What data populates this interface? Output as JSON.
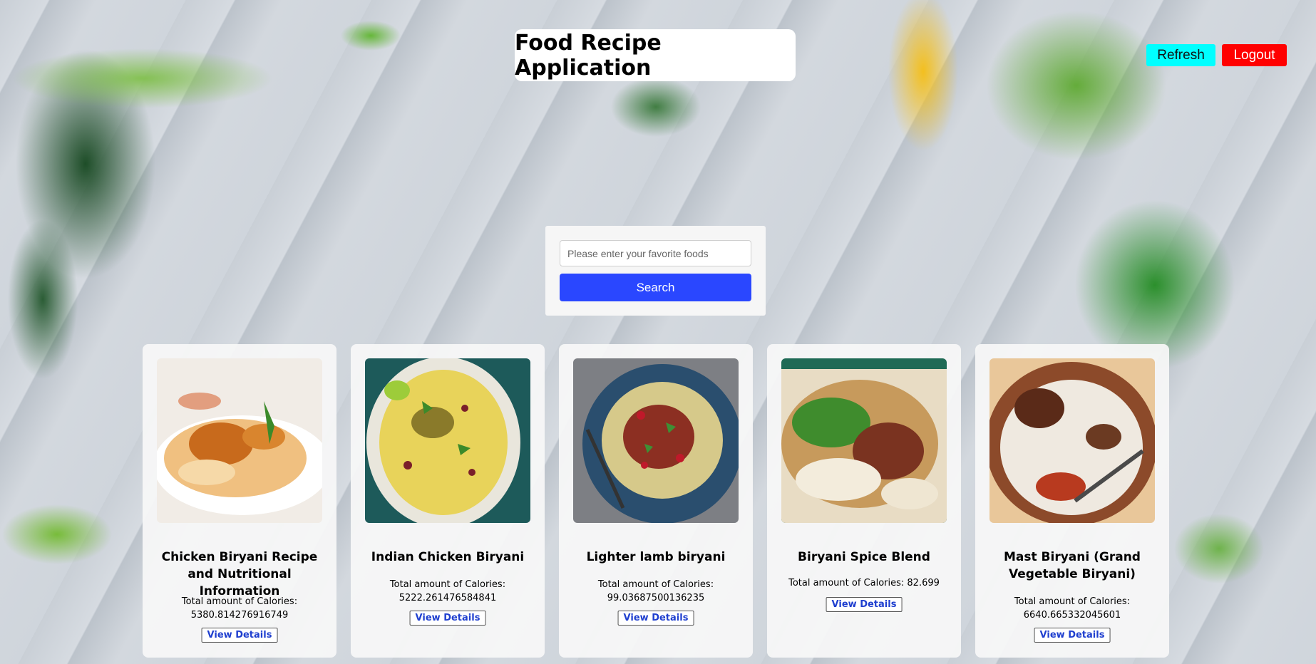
{
  "app": {
    "title": "Food Recipe Application"
  },
  "header": {
    "refresh_label": "Refresh",
    "logout_label": "Logout"
  },
  "search": {
    "placeholder": "Please enter your favorite foods",
    "value": "",
    "button_label": "Search"
  },
  "recipes": [
    {
      "title": "Chicken Biryani Recipe and Nutritional Information",
      "calories_label": "Total amount of Calories:",
      "calories": "5380.814276916749",
      "button": "View Details"
    },
    {
      "title": "Indian Chicken Biryani",
      "calories_label": "Total amount of Calories:",
      "calories": "5222.261476584841",
      "button": "View Details"
    },
    {
      "title": "Lighter lamb biryani",
      "calories_label": "Total amount of Calories:",
      "calories": "99.03687500136235",
      "button": "View Details"
    },
    {
      "title": "Biryani Spice Blend",
      "calories_label": "Total amount of Calories:",
      "calories": "82.699",
      "button": "View Details"
    },
    {
      "title": "Mast Biryani (Grand Vegetable Biryani)",
      "calories_label": "Total amount of Calories:",
      "calories": "6640.665332045601",
      "button": "View Details"
    }
  ]
}
